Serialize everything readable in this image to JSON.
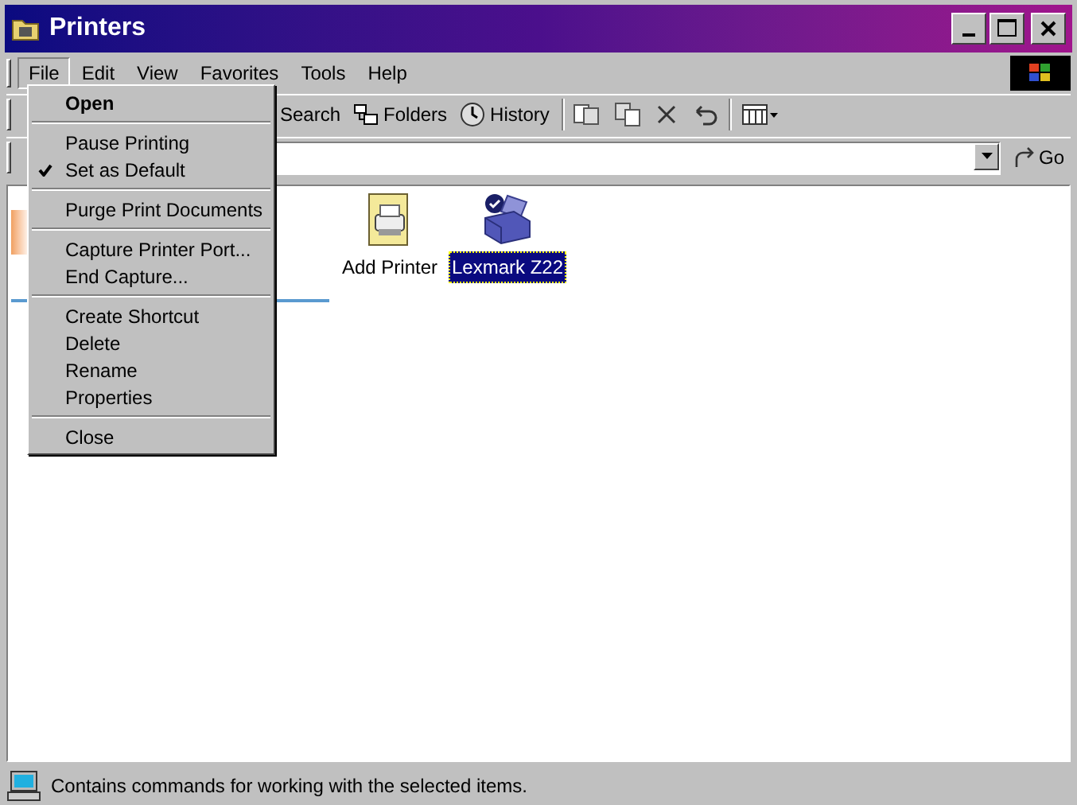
{
  "window": {
    "title": "Printers"
  },
  "menu_bar": [
    {
      "label": "File",
      "selected": true
    },
    {
      "label": "Edit",
      "selected": false
    },
    {
      "label": "View",
      "selected": false
    },
    {
      "label": "Favorites",
      "selected": false
    },
    {
      "label": "Tools",
      "selected": false
    },
    {
      "label": "Help",
      "selected": false
    }
  ],
  "file_menu": [
    [
      {
        "label": "Open",
        "default": true,
        "checked": false
      }
    ],
    [
      {
        "label": "Pause Printing",
        "default": false,
        "checked": false
      },
      {
        "label": "Set as Default",
        "default": false,
        "checked": true
      }
    ],
    [
      {
        "label": "Purge Print Documents",
        "default": false,
        "checked": false
      }
    ],
    [
      {
        "label": "Capture Printer Port...",
        "default": false,
        "checked": false
      },
      {
        "label": "End Capture...",
        "default": false,
        "checked": false
      }
    ],
    [
      {
        "label": "Create Shortcut",
        "default": false,
        "checked": false
      },
      {
        "label": "Delete",
        "default": false,
        "checked": false
      },
      {
        "label": "Rename",
        "default": false,
        "checked": false
      },
      {
        "label": "Properties",
        "default": false,
        "checked": false
      }
    ],
    [
      {
        "label": "Close",
        "default": false,
        "checked": false
      }
    ]
  ],
  "toolbar": [
    {
      "kind": "search",
      "label": "Search"
    },
    {
      "kind": "folders",
      "label": "Folders"
    },
    {
      "kind": "history",
      "label": "History"
    }
  ],
  "address_bar": {
    "go": "Go"
  },
  "items": [
    {
      "kind": "add",
      "label": "Add Printer",
      "selected": false
    },
    {
      "kind": "printer",
      "label": "Lexmark Z22",
      "selected": true
    }
  ],
  "status_bar": {
    "text": "Contains commands for working with the selected items."
  }
}
